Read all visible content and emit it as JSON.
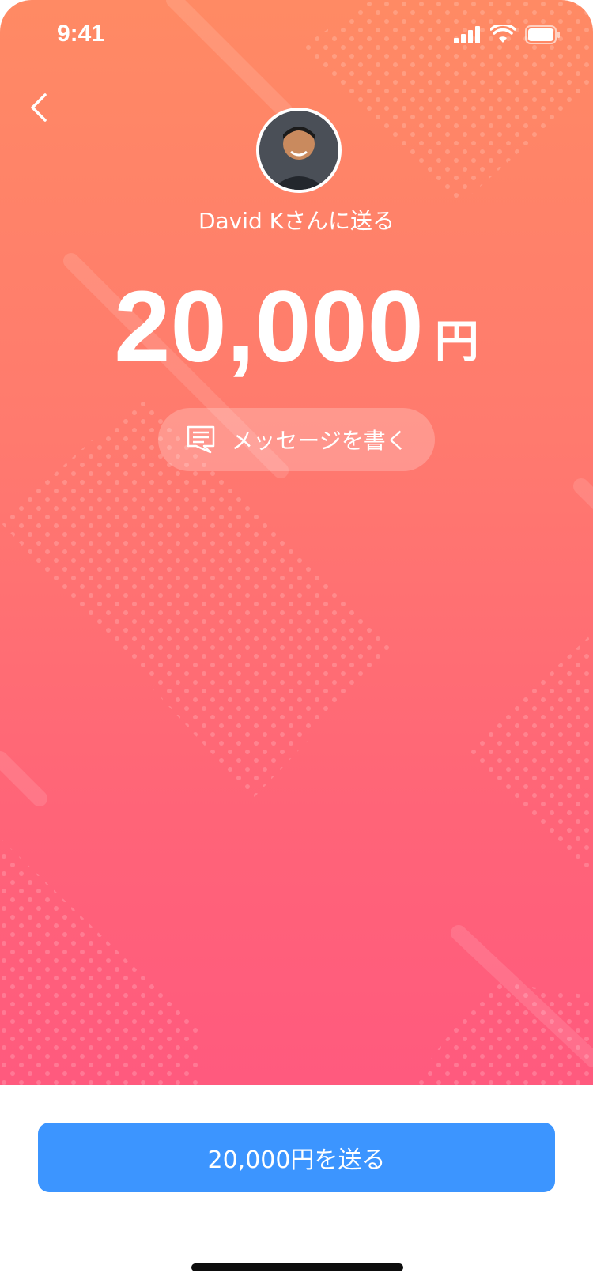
{
  "status_bar": {
    "time": "9:41",
    "signal_icon": "signal-icon",
    "wifi_icon": "wifi-icon",
    "battery_icon": "battery-icon"
  },
  "header": {
    "back_icon": "chevron-left-icon"
  },
  "recipient": {
    "name_line": "David Kさんに送る",
    "avatar": "avatar"
  },
  "amount": {
    "value": "20,000",
    "unit": "円"
  },
  "message_button": {
    "label": "メッセージを書く",
    "icon": "message-icon"
  },
  "send_button": {
    "label": "20,000円を送る"
  },
  "colors": {
    "gradient_top": "#ff8a64",
    "gradient_bottom": "#ff5a7e",
    "primary_button": "#3c95ff"
  }
}
